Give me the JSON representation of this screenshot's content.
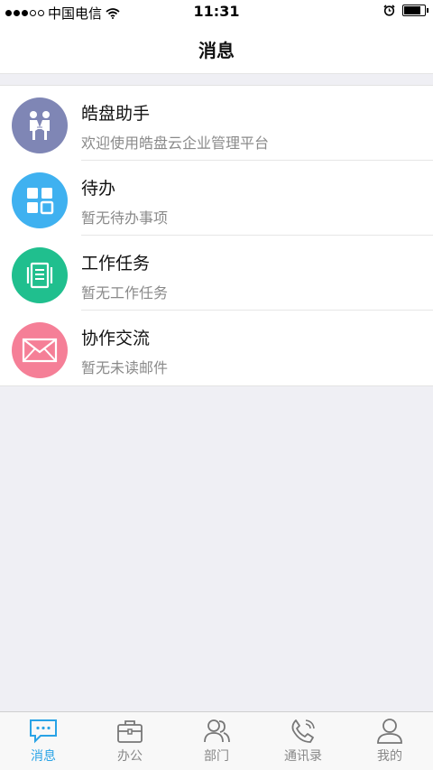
{
  "status": {
    "carrier": "中国电信",
    "time": "11:31"
  },
  "header": {
    "title": "消息"
  },
  "messages": [
    {
      "title": "皓盘助手",
      "subtitle": "欢迎使用皓盘云企业管理平台",
      "color": "#7f86b5",
      "icon": "people-handshake-icon"
    },
    {
      "title": "待办",
      "subtitle": "暂无待办事项",
      "color": "#3fb1f0",
      "icon": "grid-icon"
    },
    {
      "title": "工作任务",
      "subtitle": "暂无工作任务",
      "color": "#20bf8e",
      "icon": "document-icon"
    },
    {
      "title": "协作交流",
      "subtitle": "暂无未读邮件",
      "color": "#f57f97",
      "icon": "mail-icon"
    }
  ],
  "tabs": [
    {
      "label": "消息",
      "icon": "chat-icon",
      "active": true
    },
    {
      "label": "办公",
      "icon": "briefcase-icon",
      "active": false
    },
    {
      "label": "部门",
      "icon": "group-icon",
      "active": false
    },
    {
      "label": "通讯录",
      "icon": "phone-icon",
      "active": false
    },
    {
      "label": "我的",
      "icon": "user-icon",
      "active": false
    }
  ],
  "colors": {
    "accent": "#29a3e6",
    "background": "#efeff4"
  }
}
